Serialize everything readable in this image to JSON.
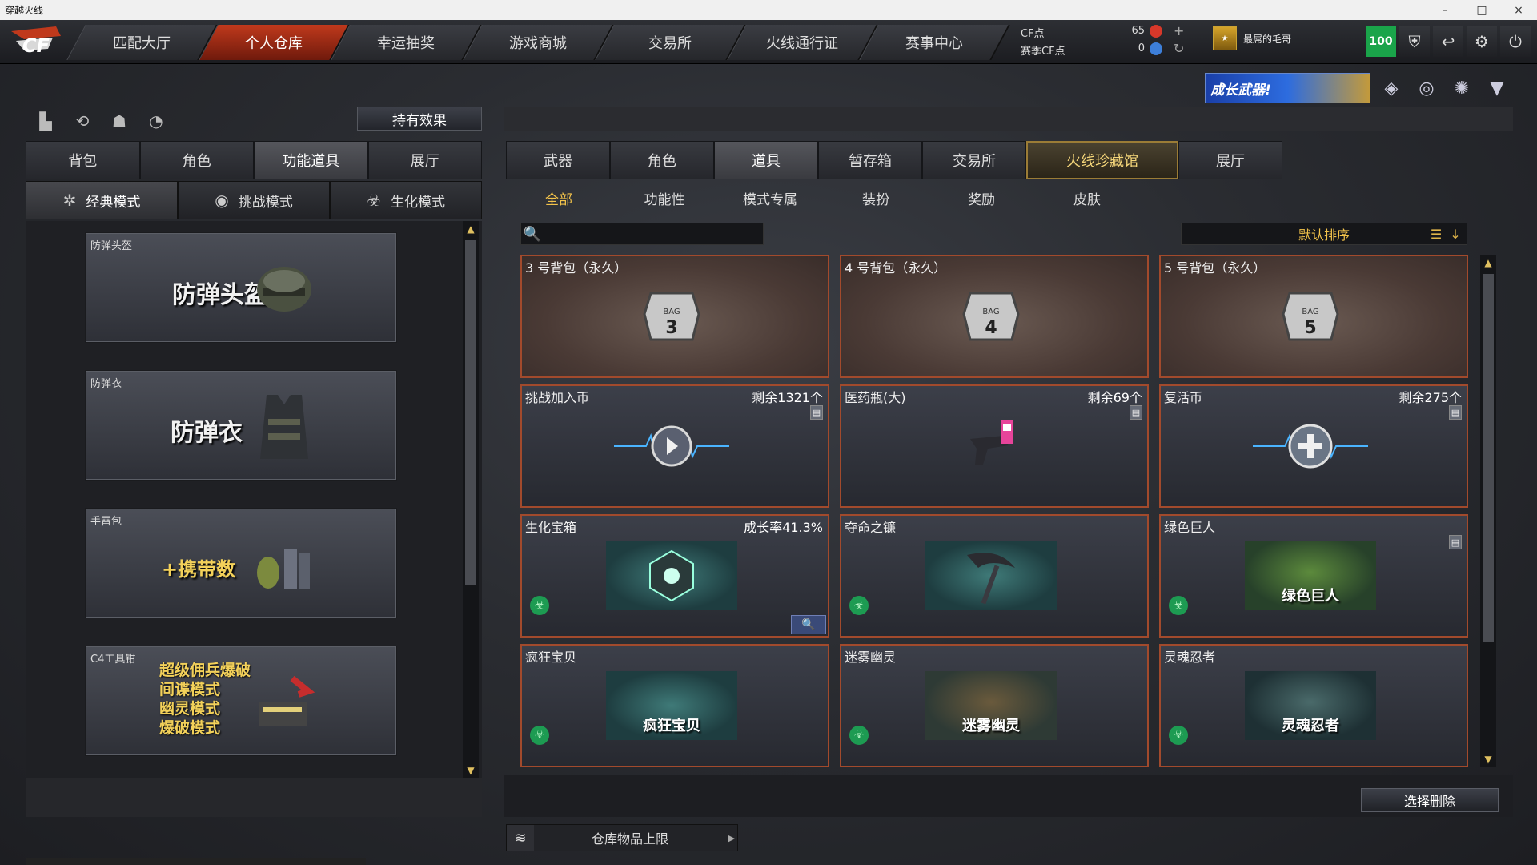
{
  "window": {
    "title": "穿越火线",
    "controls": [
      "–",
      "□",
      "×"
    ]
  },
  "nav": {
    "tabs": [
      {
        "label": "匹配大厅",
        "active": false
      },
      {
        "label": "个人仓库",
        "active": true
      },
      {
        "label": "幸运抽奖",
        "active": false
      },
      {
        "label": "游戏商城",
        "active": false
      },
      {
        "label": "交易所",
        "active": false
      },
      {
        "label": "火线通行证",
        "active": false
      },
      {
        "label": "赛事中心",
        "active": false
      }
    ]
  },
  "currency": {
    "cf_label": "CF点",
    "cf_value": "65",
    "season_label": "赛季CF点",
    "season_value": "0",
    "add_icon": "plus-icon",
    "refresh_icon": "refresh-icon"
  },
  "user": {
    "name": "最屌的毛哥",
    "rank_icon": "rank-badge-icon"
  },
  "top_icons": {
    "vip": "100",
    "shield": "shield-icon",
    "return": "return-icon",
    "settings": "gear-icon",
    "power": "power-icon"
  },
  "banner": {
    "text": "成长武器!"
  },
  "left": {
    "effects_button": "持有效果",
    "tabs": [
      {
        "label": "背包",
        "active": false
      },
      {
        "label": "角色",
        "active": false
      },
      {
        "label": "功能道具",
        "active": true
      },
      {
        "label": "展厅",
        "active": false
      }
    ],
    "modes": [
      {
        "label": "经典模式",
        "icon": "star-icon",
        "active": true
      },
      {
        "label": "挑战模式",
        "icon": "pulse-icon",
        "active": false
      },
      {
        "label": "生化模式",
        "icon": "biohazard-icon",
        "active": false
      }
    ],
    "equipment": [
      {
        "small": "防弹头盔",
        "big": "防弹头盔"
      },
      {
        "small": "防弹衣",
        "big": "防弹衣"
      },
      {
        "small": "手雷包",
        "big": "+携带数"
      },
      {
        "small": "C4工具钳",
        "lines": [
          "超级佣兵爆破",
          "间谍模式",
          "幽灵模式",
          "爆破模式"
        ]
      }
    ]
  },
  "right": {
    "tabs": [
      {
        "label": "武器",
        "active": false
      },
      {
        "label": "角色",
        "active": false
      },
      {
        "label": "道具",
        "active": true
      },
      {
        "label": "暂存箱",
        "active": false
      },
      {
        "label": "交易所",
        "active": false
      },
      {
        "label": "火线珍藏馆",
        "active": false,
        "gold": true
      },
      {
        "label": "展厅",
        "active": false
      }
    ],
    "subtabs": [
      {
        "label": "全部",
        "active": true
      },
      {
        "label": "功能性",
        "active": false
      },
      {
        "label": "模式专属",
        "active": false
      },
      {
        "label": "装扮",
        "active": false
      },
      {
        "label": "奖励",
        "active": false
      },
      {
        "label": "皮肤",
        "active": false
      }
    ],
    "search": {
      "placeholder": "",
      "value": ""
    },
    "sort": {
      "label": "默认排序"
    },
    "items": [
      {
        "name": "3 号背包（永久）",
        "right": "",
        "bag_num": "3"
      },
      {
        "name": "4 号背包（永久）",
        "right": "",
        "bag_num": "4"
      },
      {
        "name": "5 号背包（永久）",
        "right": "",
        "bag_num": "5"
      },
      {
        "name": "挑战加入币",
        "right": "剩余1321个"
      },
      {
        "name": "医药瓶(大)",
        "right": "剩余69个"
      },
      {
        "name": "复活币",
        "right": "剩余275个"
      },
      {
        "name": "生化宝箱",
        "right": "成长率41.3%"
      },
      {
        "name": "夺命之镰",
        "right": ""
      },
      {
        "name": "绿色巨人",
        "right": "",
        "img_caption": "绿色巨人"
      },
      {
        "name": "疯狂宝贝",
        "right": "",
        "img_caption": "疯狂宝贝"
      },
      {
        "name": "迷雾幽灵",
        "right": "",
        "img_caption": "迷雾幽灵"
      },
      {
        "name": "灵魂忍者",
        "right": "",
        "img_caption": "灵魂忍者"
      }
    ],
    "delete_button": "选择删除",
    "capacity_label": "仓库物品上限"
  },
  "colors": {
    "accent_red": "#c0391c",
    "card_border": "#a24a2c",
    "gold": "#f3c34a",
    "vip_green": "#1aa44a"
  }
}
